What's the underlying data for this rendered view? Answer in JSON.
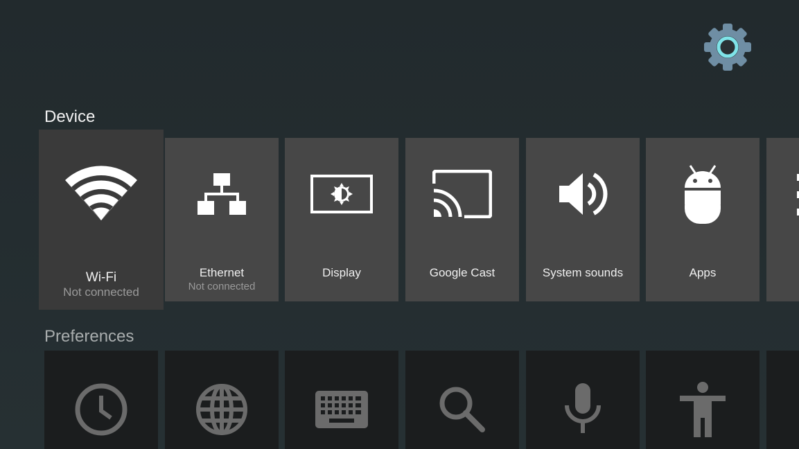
{
  "header": {
    "settings_icon": "gear-icon",
    "accent_color": "#5bc0c8"
  },
  "device": {
    "title": "Device",
    "items": [
      {
        "label": "Wi-Fi",
        "sub": "Not connected",
        "icon": "wifi-icon"
      },
      {
        "label": "Ethernet",
        "sub": "Not connected",
        "icon": "network-icon"
      },
      {
        "label": "Display",
        "sub": "",
        "icon": "display-icon"
      },
      {
        "label": "Google Cast",
        "sub": "",
        "icon": "cast-icon"
      },
      {
        "label": "System sounds",
        "sub": "",
        "icon": "speaker-icon"
      },
      {
        "label": "Apps",
        "sub": "",
        "icon": "android-icon"
      }
    ]
  },
  "preferences": {
    "title": "Preferences",
    "items": [
      {
        "icon": "clock-icon"
      },
      {
        "icon": "globe-icon"
      },
      {
        "icon": "keyboard-icon"
      },
      {
        "icon": "search-icon"
      },
      {
        "icon": "microphone-icon"
      },
      {
        "icon": "accessibility-icon"
      }
    ]
  }
}
